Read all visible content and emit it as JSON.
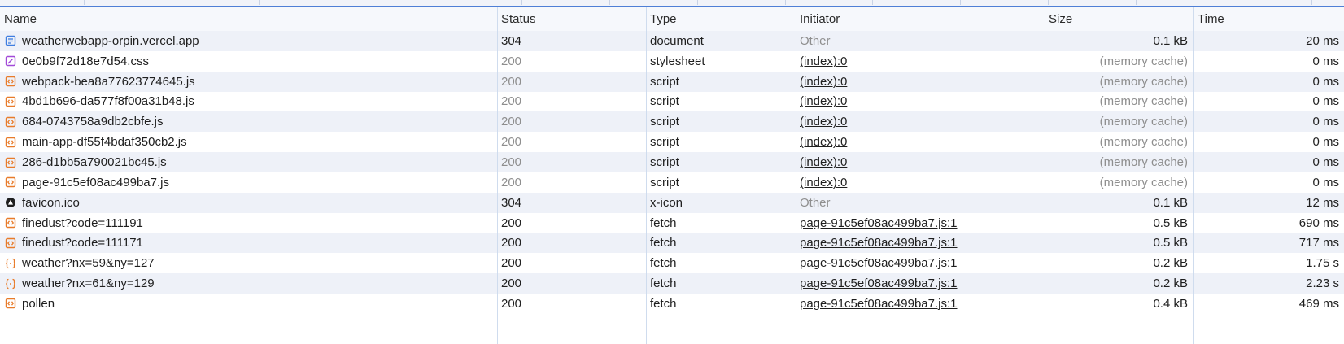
{
  "colors": {
    "document": "#3f7de0",
    "stylesheet": "#a24ad8",
    "script": "#e87b2a",
    "fetch": "#e87b2a",
    "xicon": "#1f1f1f"
  },
  "columns": {
    "name": "Name",
    "status": "Status",
    "type": "Type",
    "initiator": "Initiator",
    "size": "Size",
    "time": "Time"
  },
  "requests": [
    {
      "name": "weatherwebapp-orpin.vercel.app",
      "icon": "document-icon",
      "status": "304",
      "status_muted": false,
      "type": "document",
      "initiator": "Other",
      "initiator_link": false,
      "size": "0.1 kB",
      "size_muted": false,
      "time": "20 ms"
    },
    {
      "name": "0e0b9f72d18e7d54.css",
      "icon": "stylesheet-icon",
      "status": "200",
      "status_muted": true,
      "type": "stylesheet",
      "initiator": "(index):0",
      "initiator_link": true,
      "size": "(memory cache)",
      "size_muted": true,
      "time": "0 ms"
    },
    {
      "name": "webpack-bea8a77623774645.js",
      "icon": "script-icon",
      "status": "200",
      "status_muted": true,
      "type": "script",
      "initiator": "(index):0",
      "initiator_link": true,
      "size": "(memory cache)",
      "size_muted": true,
      "time": "0 ms"
    },
    {
      "name": "4bd1b696-da577f8f00a31b48.js",
      "icon": "script-icon",
      "status": "200",
      "status_muted": true,
      "type": "script",
      "initiator": "(index):0",
      "initiator_link": true,
      "size": "(memory cache)",
      "size_muted": true,
      "time": "0 ms"
    },
    {
      "name": "684-0743758a9db2cbfe.js",
      "icon": "script-icon",
      "status": "200",
      "status_muted": true,
      "type": "script",
      "initiator": "(index):0",
      "initiator_link": true,
      "size": "(memory cache)",
      "size_muted": true,
      "time": "0 ms"
    },
    {
      "name": "main-app-df55f4bdaf350cb2.js",
      "icon": "script-icon",
      "status": "200",
      "status_muted": true,
      "type": "script",
      "initiator": "(index):0",
      "initiator_link": true,
      "size": "(memory cache)",
      "size_muted": true,
      "time": "0 ms"
    },
    {
      "name": "286-d1bb5a790021bc45.js",
      "icon": "script-icon",
      "status": "200",
      "status_muted": true,
      "type": "script",
      "initiator": "(index):0",
      "initiator_link": true,
      "size": "(memory cache)",
      "size_muted": true,
      "time": "0 ms"
    },
    {
      "name": "page-91c5ef08ac499ba7.js",
      "icon": "script-icon",
      "status": "200",
      "status_muted": true,
      "type": "script",
      "initiator": "(index):0",
      "initiator_link": true,
      "size": "(memory cache)",
      "size_muted": true,
      "time": "0 ms"
    },
    {
      "name": "favicon.ico",
      "icon": "favicon-icon",
      "status": "304",
      "status_muted": false,
      "type": "x-icon",
      "initiator": "Other",
      "initiator_link": false,
      "size": "0.1 kB",
      "size_muted": false,
      "time": "12 ms"
    },
    {
      "name": "finedust?code=111191",
      "icon": "fetch-icon",
      "status": "200",
      "status_muted": false,
      "type": "fetch",
      "initiator": "page-91c5ef08ac499ba7.js:1",
      "initiator_link": true,
      "size": "0.5 kB",
      "size_muted": false,
      "time": "690 ms"
    },
    {
      "name": "finedust?code=111171",
      "icon": "fetch-icon",
      "status": "200",
      "status_muted": false,
      "type": "fetch",
      "initiator": "page-91c5ef08ac499ba7.js:1",
      "initiator_link": true,
      "size": "0.5 kB",
      "size_muted": false,
      "time": "717 ms"
    },
    {
      "name": "weather?nx=59&ny=127",
      "icon": "json-icon",
      "status": "200",
      "status_muted": false,
      "type": "fetch",
      "initiator": "page-91c5ef08ac499ba7.js:1",
      "initiator_link": true,
      "size": "0.2 kB",
      "size_muted": false,
      "time": "1.75 s"
    },
    {
      "name": "weather?nx=61&ny=129",
      "icon": "json-icon",
      "status": "200",
      "status_muted": false,
      "type": "fetch",
      "initiator": "page-91c5ef08ac499ba7.js:1",
      "initiator_link": true,
      "size": "0.2 kB",
      "size_muted": false,
      "time": "2.23 s"
    },
    {
      "name": "pollen",
      "icon": "fetch-icon",
      "status": "200",
      "status_muted": false,
      "type": "fetch",
      "initiator": "page-91c5ef08ac499ba7.js:1",
      "initiator_link": true,
      "size": "0.4 kB",
      "size_muted": false,
      "time": "469 ms"
    }
  ]
}
